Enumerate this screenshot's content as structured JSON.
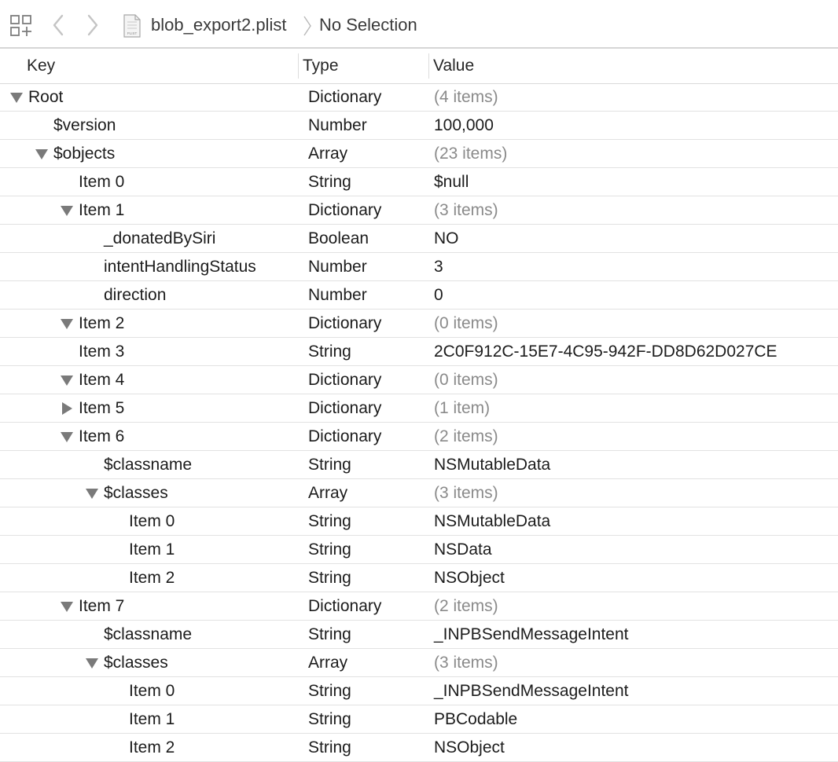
{
  "jumpbar": {
    "filename": "blob_export2.plist",
    "selection": "No Selection",
    "file_icon_label": "PLIST"
  },
  "columns": {
    "key": "Key",
    "type": "Type",
    "value": "Value"
  },
  "rows": [
    {
      "key": "Root",
      "type": "Dictionary",
      "value": "(4 items)",
      "depth": 0,
      "disclosure": "expanded",
      "is_count": true
    },
    {
      "key": "$version",
      "type": "Number",
      "value": "100,000",
      "depth": 1,
      "disclosure": "none",
      "is_count": false
    },
    {
      "key": "$objects",
      "type": "Array",
      "value": "(23 items)",
      "depth": 1,
      "disclosure": "expanded",
      "is_count": true
    },
    {
      "key": "Item 0",
      "type": "String",
      "value": "$null",
      "depth": 2,
      "disclosure": "none",
      "is_count": false
    },
    {
      "key": "Item 1",
      "type": "Dictionary",
      "value": "(3 items)",
      "depth": 2,
      "disclosure": "expanded",
      "is_count": true
    },
    {
      "key": "_donatedBySiri",
      "type": "Boolean",
      "value": "NO",
      "depth": 3,
      "disclosure": "none",
      "is_count": false
    },
    {
      "key": "intentHandlingStatus",
      "type": "Number",
      "value": "3",
      "depth": 3,
      "disclosure": "none",
      "is_count": false
    },
    {
      "key": "direction",
      "type": "Number",
      "value": "0",
      "depth": 3,
      "disclosure": "none",
      "is_count": false
    },
    {
      "key": "Item 2",
      "type": "Dictionary",
      "value": "(0 items)",
      "depth": 2,
      "disclosure": "expanded",
      "is_count": true
    },
    {
      "key": "Item 3",
      "type": "String",
      "value": "2C0F912C-15E7-4C95-942F-DD8D62D027CE",
      "depth": 2,
      "disclosure": "none",
      "is_count": false
    },
    {
      "key": "Item 4",
      "type": "Dictionary",
      "value": "(0 items)",
      "depth": 2,
      "disclosure": "expanded",
      "is_count": true
    },
    {
      "key": "Item 5",
      "type": "Dictionary",
      "value": "(1 item)",
      "depth": 2,
      "disclosure": "collapsed",
      "is_count": true
    },
    {
      "key": "Item 6",
      "type": "Dictionary",
      "value": "(2 items)",
      "depth": 2,
      "disclosure": "expanded",
      "is_count": true
    },
    {
      "key": "$classname",
      "type": "String",
      "value": "NSMutableData",
      "depth": 3,
      "disclosure": "none",
      "is_count": false
    },
    {
      "key": "$classes",
      "type": "Array",
      "value": "(3 items)",
      "depth": 3,
      "disclosure": "expanded",
      "is_count": true
    },
    {
      "key": "Item 0",
      "type": "String",
      "value": "NSMutableData",
      "depth": 4,
      "disclosure": "none",
      "is_count": false
    },
    {
      "key": "Item 1",
      "type": "String",
      "value": "NSData",
      "depth": 4,
      "disclosure": "none",
      "is_count": false
    },
    {
      "key": "Item 2",
      "type": "String",
      "value": "NSObject",
      "depth": 4,
      "disclosure": "none",
      "is_count": false
    },
    {
      "key": "Item 7",
      "type": "Dictionary",
      "value": "(2 items)",
      "depth": 2,
      "disclosure": "expanded",
      "is_count": true
    },
    {
      "key": "$classname",
      "type": "String",
      "value": "_INPBSendMessageIntent",
      "depth": 3,
      "disclosure": "none",
      "is_count": false
    },
    {
      "key": "$classes",
      "type": "Array",
      "value": "(3 items)",
      "depth": 3,
      "disclosure": "expanded",
      "is_count": true
    },
    {
      "key": "Item 0",
      "type": "String",
      "value": "_INPBSendMessageIntent",
      "depth": 4,
      "disclosure": "none",
      "is_count": false
    },
    {
      "key": "Item 1",
      "type": "String",
      "value": "PBCodable",
      "depth": 4,
      "disclosure": "none",
      "is_count": false
    },
    {
      "key": "Item 2",
      "type": "String",
      "value": "NSObject",
      "depth": 4,
      "disclosure": "none",
      "is_count": false
    }
  ],
  "colors": {
    "count_text": "#8a8a8a",
    "disclosure": "#7a7a7a",
    "row_separator": "#e2e2e2"
  },
  "icons": {
    "grid": "related-items-grid-icon",
    "back": "chevron-left-icon",
    "forward": "chevron-right-icon",
    "file": "plist-file-icon",
    "separator": "path-separator-chevron-icon"
  }
}
